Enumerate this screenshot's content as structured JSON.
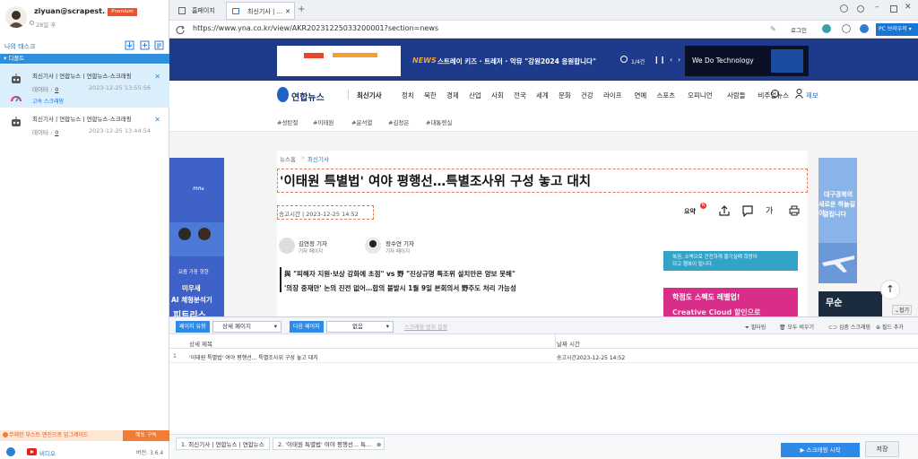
{
  "user": {
    "name": "ziyuan@scrapest...",
    "badge": "Premium",
    "days": "28일 후"
  },
  "left": {
    "tasks_title": "나의 태스크",
    "folder": "디폴트",
    "tasks": [
      {
        "title": "최신기사 | 연합뉴스 | 연합뉴스-스크래핑",
        "data_label": "데이터 :",
        "data_value": "0",
        "time": "2023-12-25 13:55:56",
        "mode": "고속 스크래핑"
      },
      {
        "title": "최신기사 | 연합뉴스 | 연합뉴스-스크래핑",
        "data_label": "데이터 :",
        "data_value": "0",
        "time": "2023-12-25 13:44:54",
        "mode": ""
      }
    ],
    "upgrade_text": "무제한 부스트 엔진으로 업그레이드",
    "gift_btn": "혜토 구독",
    "video_label": "비디오",
    "version": "버전: 3.6.4"
  },
  "browser": {
    "tabs": [
      {
        "label": "홈페이지"
      },
      {
        "label": "최신기사 | ..."
      }
    ],
    "url": "https://www.yna.co.kr/view/AKR20231225033200001?section=news",
    "login": "로그인",
    "pc_button": "PC 브라우저"
  },
  "site": {
    "banner_news": "NEWS",
    "banner_text": "스트레이 키즈 · 트레저 · 악뮤 \"강원2024 응원합니다\"",
    "banner_count": "1/4건",
    "banner_right": "We Do Technology",
    "logo_text": "연합뉴스",
    "nav": [
      "최신기사",
      "정치",
      "북한",
      "경제",
      "산업",
      "사회",
      "전국",
      "세계",
      "문화",
      "건강",
      "라이프",
      "연예",
      "스포츠",
      "오피니언",
      "사람들",
      "비주얼뉴스",
      "제보"
    ],
    "tags": [
      "#성탄절",
      "#이태원",
      "#윤석열",
      "#김정은",
      "#대통령실"
    ],
    "breadcrumb_home": "뉴스홈",
    "breadcrumb_section": "최신기사",
    "headline": "'이태원 특별법' 여야 평행선…특별조사위 구성 놓고 대치",
    "sendtime": "송고시간 | 2023-12-25 14:52",
    "summary_btn": "요약",
    "summary_badge": "N",
    "reporters": [
      {
        "name": "김연정 기자",
        "page": "기자 페이지"
      },
      {
        "name": "정수연 기자",
        "page": "기자 페이지"
      }
    ],
    "sub1": "與 \"피해자 지원·보상 강화에 초점\" vs 野 \"진상규명 특조위 설치만은 양보 못해\"",
    "sub2": "'의장 중재안' 논의 진전 없어…합의 불발시 1월 9일 본회의서 野주도 처리 가능성",
    "ad_left_top": "fitfia",
    "ad_left_1": "요즘 가장 핫한",
    "ad_left_2": "미우새",
    "ad_left_3": "AI 체형분석기",
    "ad_left_4": "피트리스",
    "ad_mid_text": "복권, 소액으로 건전하게 즐기실때 희망이되고 행복이 됩니다.",
    "ad_mid2_text": "학점도 스펙도 레벨업!",
    "ad_mid2_sub": "Creative Cloud 할인으로",
    "ad_right_1": "대구경북의",
    "ad_right_2": "새로운 하늘길이",
    "ad_right_3": "열립니다",
    "ad_right_4": "무순",
    "fold_label": "접기"
  },
  "crawler": {
    "page_type_label": "페이지 유형",
    "page_type_value": "상세 페이지",
    "next_page_label": "다음 페이지",
    "next_page_value": "없음",
    "scrape_range": "스크래핑 범위 설정",
    "tools": [
      "필터링",
      "모두 비우기",
      "심층 스크래핑",
      "필드 추가"
    ],
    "columns": [
      "상세 제목",
      "날짜 시간"
    ],
    "rows": [
      {
        "n": "1",
        "title": "'이태원 특별법' 여야 평행선... 특별조사위 구성 놓고 대치",
        "date": "송고시간2023-12-25 14:52"
      }
    ],
    "bottom_tabs": [
      "1. 최신기사 | 연합뉴스 | 연합뉴스",
      "2. '이태원 특별법' 여야 평행선... 특..."
    ],
    "start": "▶ 스크래핑 시작",
    "save": "저장"
  }
}
